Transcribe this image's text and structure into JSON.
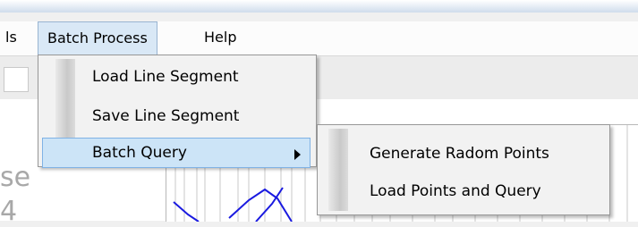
{
  "menubar": {
    "items": [
      {
        "label": "ls"
      },
      {
        "label": "Batch Process"
      },
      {
        "label": "Help"
      }
    ]
  },
  "batch_menu": {
    "items": [
      {
        "label": "Load Line Segment"
      },
      {
        "label": "Save Line Segment"
      },
      {
        "label": "Batch Query"
      }
    ]
  },
  "batch_query_submenu": {
    "items": [
      {
        "label": "Generate Radom Points"
      },
      {
        "label": "Load Points and Query"
      }
    ]
  },
  "background": {
    "side_text_1": "se",
    "side_text_2": "4"
  },
  "colors": {
    "highlight": "#cce4f7",
    "highlight_border": "#7fb2e5",
    "plot_line": "#1a1ae0"
  },
  "icons": [
    "submenu-arrow-icon"
  ]
}
